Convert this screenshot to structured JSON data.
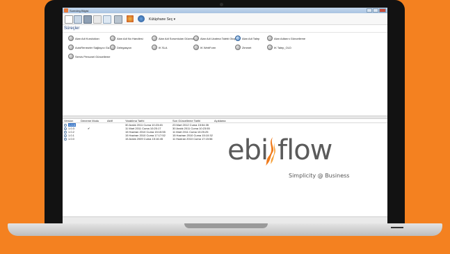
{
  "window": {
    "title": "Surecleg Bilgisi"
  },
  "toolbar": {
    "library_label": "Kütüphane Seç ▾"
  },
  "processes": {
    "header": "Süreçler",
    "items": [
      {
        "label": "Alan Adi Kurulukları",
        "icon": "process-gear-icon"
      },
      {
        "label": "Alan Adi No Handlesi",
        "icon": "process-gear-icon"
      },
      {
        "label": "Alan Adi Sorumluları Düzenleme",
        "icon": "process-gear-icon"
      },
      {
        "label": "Alan Adi Uzatma Talebi Oluştur",
        "icon": "process-gear-icon"
      },
      {
        "label": "Alan Adi Talep",
        "icon": "process-globe-icon"
      },
      {
        "label": "Alan Adlarını Güncelleme",
        "icon": "process-gear-icon"
      },
      {
        "label": "AutoRenewler Sağlayıcı Ga.",
        "icon": "process-gear-icon"
      },
      {
        "label": "Delegasyon",
        "icon": "process-gear-icon"
      },
      {
        "label": "IK SLA",
        "icon": "process-gear-icon"
      },
      {
        "label": "IK WebForm",
        "icon": "process-gear-icon"
      },
      {
        "label": "Zimmet",
        "icon": "process-gear-icon"
      },
      {
        "label": "IK Talep_OLD",
        "icon": "process-gear-icon"
      },
      {
        "label": "Servis Personel Güncelleme",
        "icon": "process-gear-icon"
      }
    ]
  },
  "versions": {
    "columns": [
      "Version",
      "Deneme Modu",
      "Aktif",
      "Yaratılma Tarihi",
      "Son Güncelleme Tarihi",
      "Açıklama"
    ],
    "rows": [
      {
        "version": "1.0.5",
        "test": "",
        "active": "",
        "created": "30 Aralık 2011 Cuma 10:23:45",
        "updated": "23 Mart 2012 Cuma 15:54:35",
        "selected": true
      },
      {
        "version": "1.0.3",
        "test": "✔",
        "active": "",
        "created": "11 Mart 2011 Cuma 10:25:17",
        "updated": "30 Aralık 2011 Cuma 10:23:55",
        "selected": false
      },
      {
        "version": "1.0.2",
        "test": "",
        "active": "",
        "created": "15 Haziran 2010 Cuma 15:15:55",
        "updated": "11 Mart 2011 Cuma 10:25:25",
        "selected": false
      },
      {
        "version": "1.0.1",
        "test": "",
        "active": "",
        "created": "15 Haziran 2010 Cuma 17:17:52",
        "updated": "15 Haziran 2010 Cuma 15:10:32",
        "selected": false
      },
      {
        "version": "1.0.0",
        "test": "",
        "active": "",
        "created": "15 Aralık 2009 Cuma 15:16:45",
        "updated": "11 Haziran 2010 Cuma 17:15:56",
        "selected": false
      }
    ]
  },
  "brand": {
    "logo_left": "ebi",
    "logo_right": "flow",
    "tagline": "Simplicity @ Business"
  },
  "colors": {
    "background": "#f48120",
    "brand_gray": "#5b5b5b",
    "flame_orange": "#f07a1a"
  }
}
